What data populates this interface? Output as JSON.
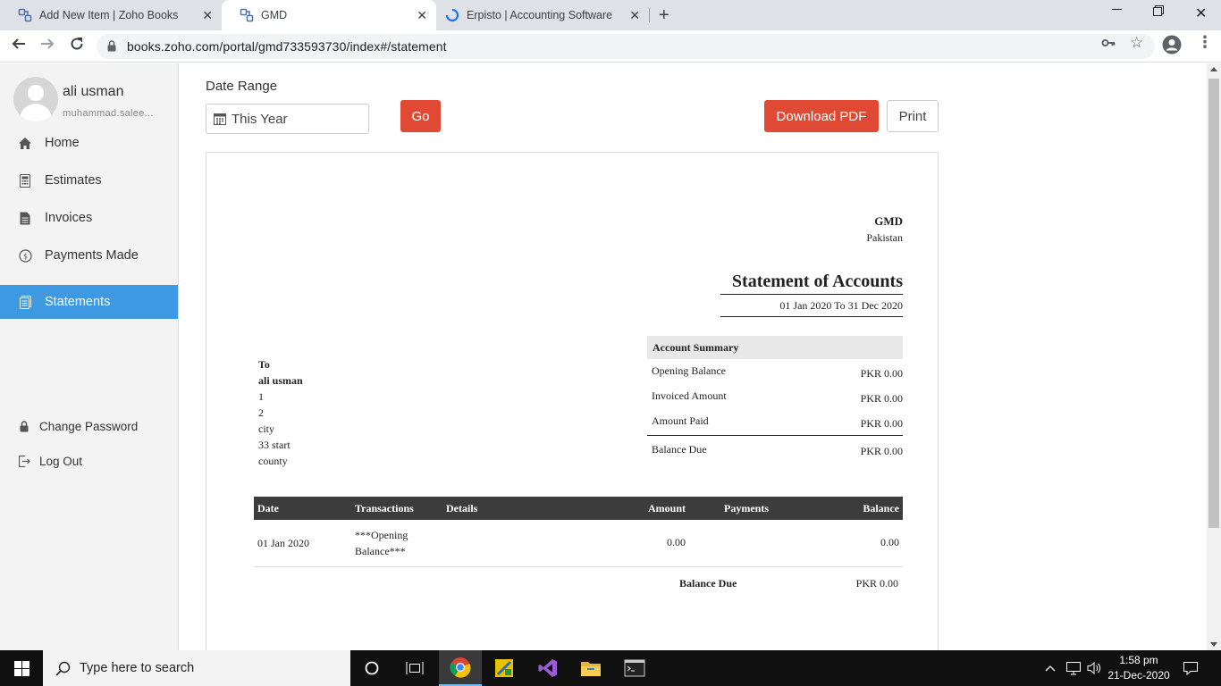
{
  "browser": {
    "tabs": [
      {
        "title": "Add New Item | Zoho Books",
        "active": false
      },
      {
        "title": "GMD",
        "active": true
      },
      {
        "title": "Erpisto | Accounting Software",
        "active": false
      }
    ],
    "url": "books.zoho.com/portal/gmd733593730/index#/statement"
  },
  "sidebar": {
    "user_name": "ali usman",
    "user_email": "muhammad.salee...",
    "items": [
      {
        "label": "Home",
        "icon": "home-icon"
      },
      {
        "label": "Estimates",
        "icon": "calculator-icon"
      },
      {
        "label": "Invoices",
        "icon": "document-icon"
      },
      {
        "label": "Payments Made",
        "icon": "coin-icon"
      },
      {
        "label": "Statements",
        "icon": "statement-icon",
        "active": true
      }
    ],
    "bottom_items": [
      {
        "label": "Change Password",
        "icon": "lock-icon"
      },
      {
        "label": "Log Out",
        "icon": "logout-icon"
      }
    ]
  },
  "toolbar": {
    "date_range_label": "Date Range",
    "date_range_value": "This Year",
    "go_label": "Go",
    "download_pdf_label": "Download PDF",
    "print_label": "Print"
  },
  "statement": {
    "org_name": "GMD",
    "org_country": "Pakistan",
    "title": "Statement of Accounts",
    "range": "01 Jan 2020 To 31 Dec 2020",
    "to": {
      "label": "To",
      "name": "ali usman",
      "lines": [
        "1",
        "2",
        "city",
        "33 start",
        "county"
      ]
    },
    "summary": {
      "heading": "Account Summary",
      "rows": [
        {
          "label": "Opening Balance",
          "value": "PKR 0.00"
        },
        {
          "label": "Invoiced Amount",
          "value": "PKR 0.00"
        },
        {
          "label": "Amount Paid",
          "value": "PKR 0.00"
        }
      ],
      "balance_due_label": "Balance Due",
      "balance_due_value": "PKR 0.00"
    },
    "table": {
      "headers": [
        "Date",
        "Transactions",
        "Details",
        "Amount",
        "Payments",
        "Balance"
      ],
      "rows": [
        {
          "date": "01 Jan 2020",
          "transaction_line1": "***Opening",
          "transaction_line2": "Balance***",
          "details": "",
          "amount": "0.00",
          "payments": "",
          "balance": "0.00"
        }
      ],
      "balance_due_label": "Balance Due",
      "balance_due_value": "PKR 0.00"
    }
  },
  "taskbar": {
    "search_placeholder": "Type here to search",
    "time": "1:58 pm",
    "date": "21-Dec-2020"
  },
  "colors": {
    "accent_red": "#e04a35",
    "active_nav": "#3d9ae2",
    "table_header": "#3c3c3c"
  }
}
